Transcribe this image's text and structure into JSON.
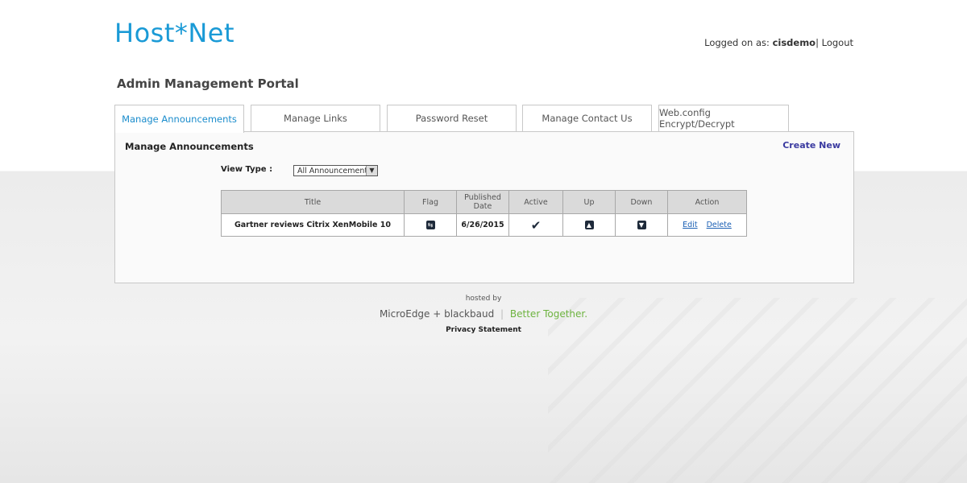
{
  "header": {
    "logo": "Host*Net",
    "logged_label": "Logged on as:",
    "username": "cisdemo",
    "separator": "|",
    "logout": "Logout"
  },
  "portal_title": "Admin Management Portal",
  "tabs": [
    {
      "label": "Manage Announcements",
      "active": true
    },
    {
      "label": "Manage Links"
    },
    {
      "label": "Password Reset"
    },
    {
      "label": "Manage Contact Us"
    },
    {
      "label": "Web.config Encrypt/Decrypt"
    }
  ],
  "panel": {
    "title": "Manage Announcements",
    "create_new": "Create New",
    "view_type_label": "View Type :",
    "view_type_selected": "All Announcements"
  },
  "table": {
    "headers": [
      "Title",
      "Flag",
      "Published Date",
      "Active",
      "Up",
      "Down",
      "Action"
    ],
    "rows": [
      {
        "title": "Gartner reviews Citrix XenMobile 10",
        "published": "6/26/2015",
        "edit": "Edit",
        "delete": "Delete"
      }
    ]
  },
  "footer": {
    "hosted_by": "hosted by",
    "brand1": "MicroEdge",
    "plus": "+",
    "brand2": "blackbaud",
    "tagline": "Better Together.",
    "privacy": "Privacy Statement"
  },
  "colors": {
    "accent": "#1a9ad6",
    "link": "#1a5fb4",
    "create_new": "#3a3aa0",
    "green": "#6db33f"
  }
}
